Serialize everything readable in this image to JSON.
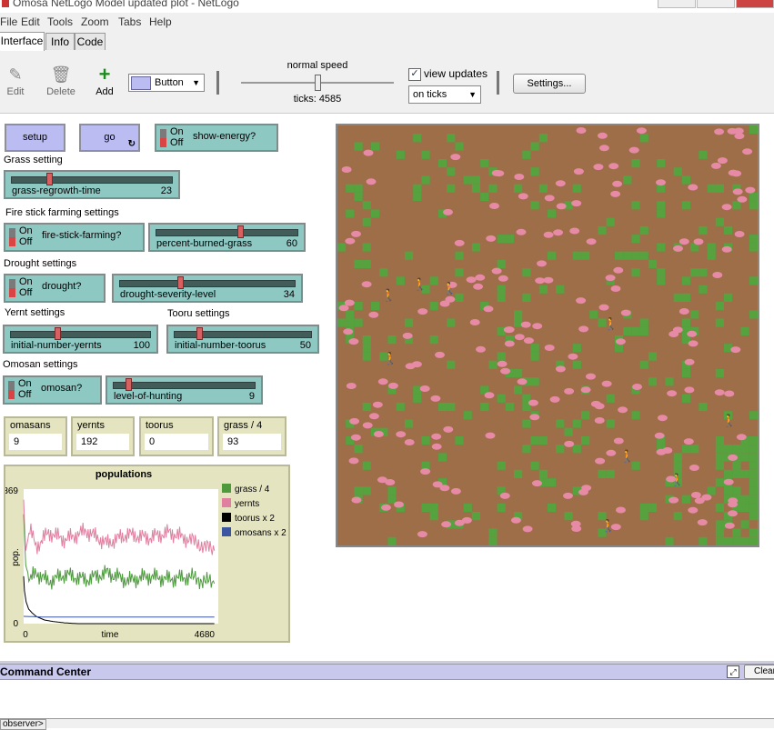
{
  "window": {
    "title": "Omosa NetLogo Model updated plot - NetLogo"
  },
  "menu": [
    "File",
    "Edit",
    "Tools",
    "Zoom",
    "Tabs",
    "Help"
  ],
  "tabs": [
    "Interface",
    "Info",
    "Code"
  ],
  "toolbar": {
    "edit_label": "Edit",
    "delete_label": "Delete",
    "add_label": "Add",
    "widget_type": "Button",
    "speed_label": "normal speed",
    "ticks_label": "ticks: 4585",
    "view_updates_label": "view updates",
    "view_updates_checked": true,
    "update_mode": "on ticks",
    "settings_label": "Settings...",
    "speed_fraction": 0.5
  },
  "buttons": {
    "setup": "setup",
    "go": "go"
  },
  "switch_on": "On",
  "switch_off": "Off",
  "switches": {
    "show_energy": "show-energy?",
    "fire_stick": "fire-stick-farming?",
    "drought": "drought?",
    "omosan": "omosan?"
  },
  "notes": {
    "grass": "Grass setting",
    "fire": "Fire stick farming settings",
    "drought": "Drought settings",
    "yernt": "Yernt settings",
    "tooru": "Tooru settings",
    "omosan": "Omosan settings"
  },
  "sliders": {
    "grass_regrowth": {
      "name": "grass-regrowth-time",
      "value": "23",
      "fraction": 0.23
    },
    "percent_burned": {
      "name": "percent-burned-grass",
      "value": "60",
      "fraction": 0.6
    },
    "drought_severity": {
      "name": "drought-severity-level",
      "value": "34",
      "fraction": 0.34
    },
    "yernts": {
      "name": "initial-number-yernts",
      "value": "100",
      "fraction": 0.33
    },
    "toorus": {
      "name": "initial-number-toorus",
      "value": "50",
      "fraction": 0.17
    },
    "hunting": {
      "name": "level-of-hunting",
      "value": "9",
      "fraction": 0.09
    }
  },
  "monitors": [
    {
      "name": "omasans",
      "value": "9"
    },
    {
      "name": "yernts",
      "value": "192"
    },
    {
      "name": "toorus",
      "value": "0"
    },
    {
      "name": "grass / 4",
      "value": "93"
    }
  ],
  "plot": {
    "title": "populations",
    "ylabel": "pop.",
    "xlabel": "time",
    "ymax_label": "369",
    "ymin_label": "0",
    "xmin_label": "0",
    "xmax_label": "4680",
    "legend": [
      {
        "name": "grass / 4",
        "color": "#4d9a3d"
      },
      {
        "name": "yernts",
        "color": "#e17fa0"
      },
      {
        "name": "toorus x 2",
        "color": "#000000"
      },
      {
        "name": "omosans x 2",
        "color": "#3b55a0"
      }
    ]
  },
  "chart_data": {
    "type": "line",
    "title": "populations",
    "xlabel": "time",
    "ylabel": "pop.",
    "xlim": [
      0,
      4680
    ],
    "ylim": [
      0,
      369
    ],
    "series": [
      {
        "name": "grass / 4",
        "color": "#4d9a3d",
        "x": [
          0,
          50,
          150,
          300,
          600,
          1000,
          1500,
          2000,
          2500,
          3000,
          3500,
          4000,
          4585
        ],
        "y": [
          300,
          160,
          120,
          140,
          115,
          135,
          120,
          140,
          118,
          130,
          122,
          128,
          110
        ]
      },
      {
        "name": "yernts",
        "color": "#e17fa0",
        "x": [
          0,
          50,
          150,
          300,
          600,
          1000,
          1500,
          2000,
          2500,
          3000,
          3500,
          4000,
          4585
        ],
        "y": [
          340,
          200,
          260,
          210,
          250,
          230,
          255,
          220,
          245,
          235,
          250,
          230,
          200
        ]
      },
      {
        "name": "toorus x 2",
        "color": "#000000",
        "x": [
          0,
          20,
          60,
          120,
          200,
          300,
          500,
          700,
          1000,
          1300,
          4585
        ],
        "y": [
          130,
          90,
          60,
          40,
          30,
          20,
          10,
          6,
          2,
          0,
          0
        ]
      },
      {
        "name": "omosans x 2",
        "color": "#3b55a0",
        "x": [
          0,
          500,
          1000,
          2000,
          3000,
          4000,
          4585
        ],
        "y": [
          20,
          18,
          18,
          18,
          18,
          18,
          18
        ]
      }
    ]
  },
  "command_center": {
    "title": "Command Center",
    "clear_label": "Clear",
    "observer_label": "observer>"
  }
}
